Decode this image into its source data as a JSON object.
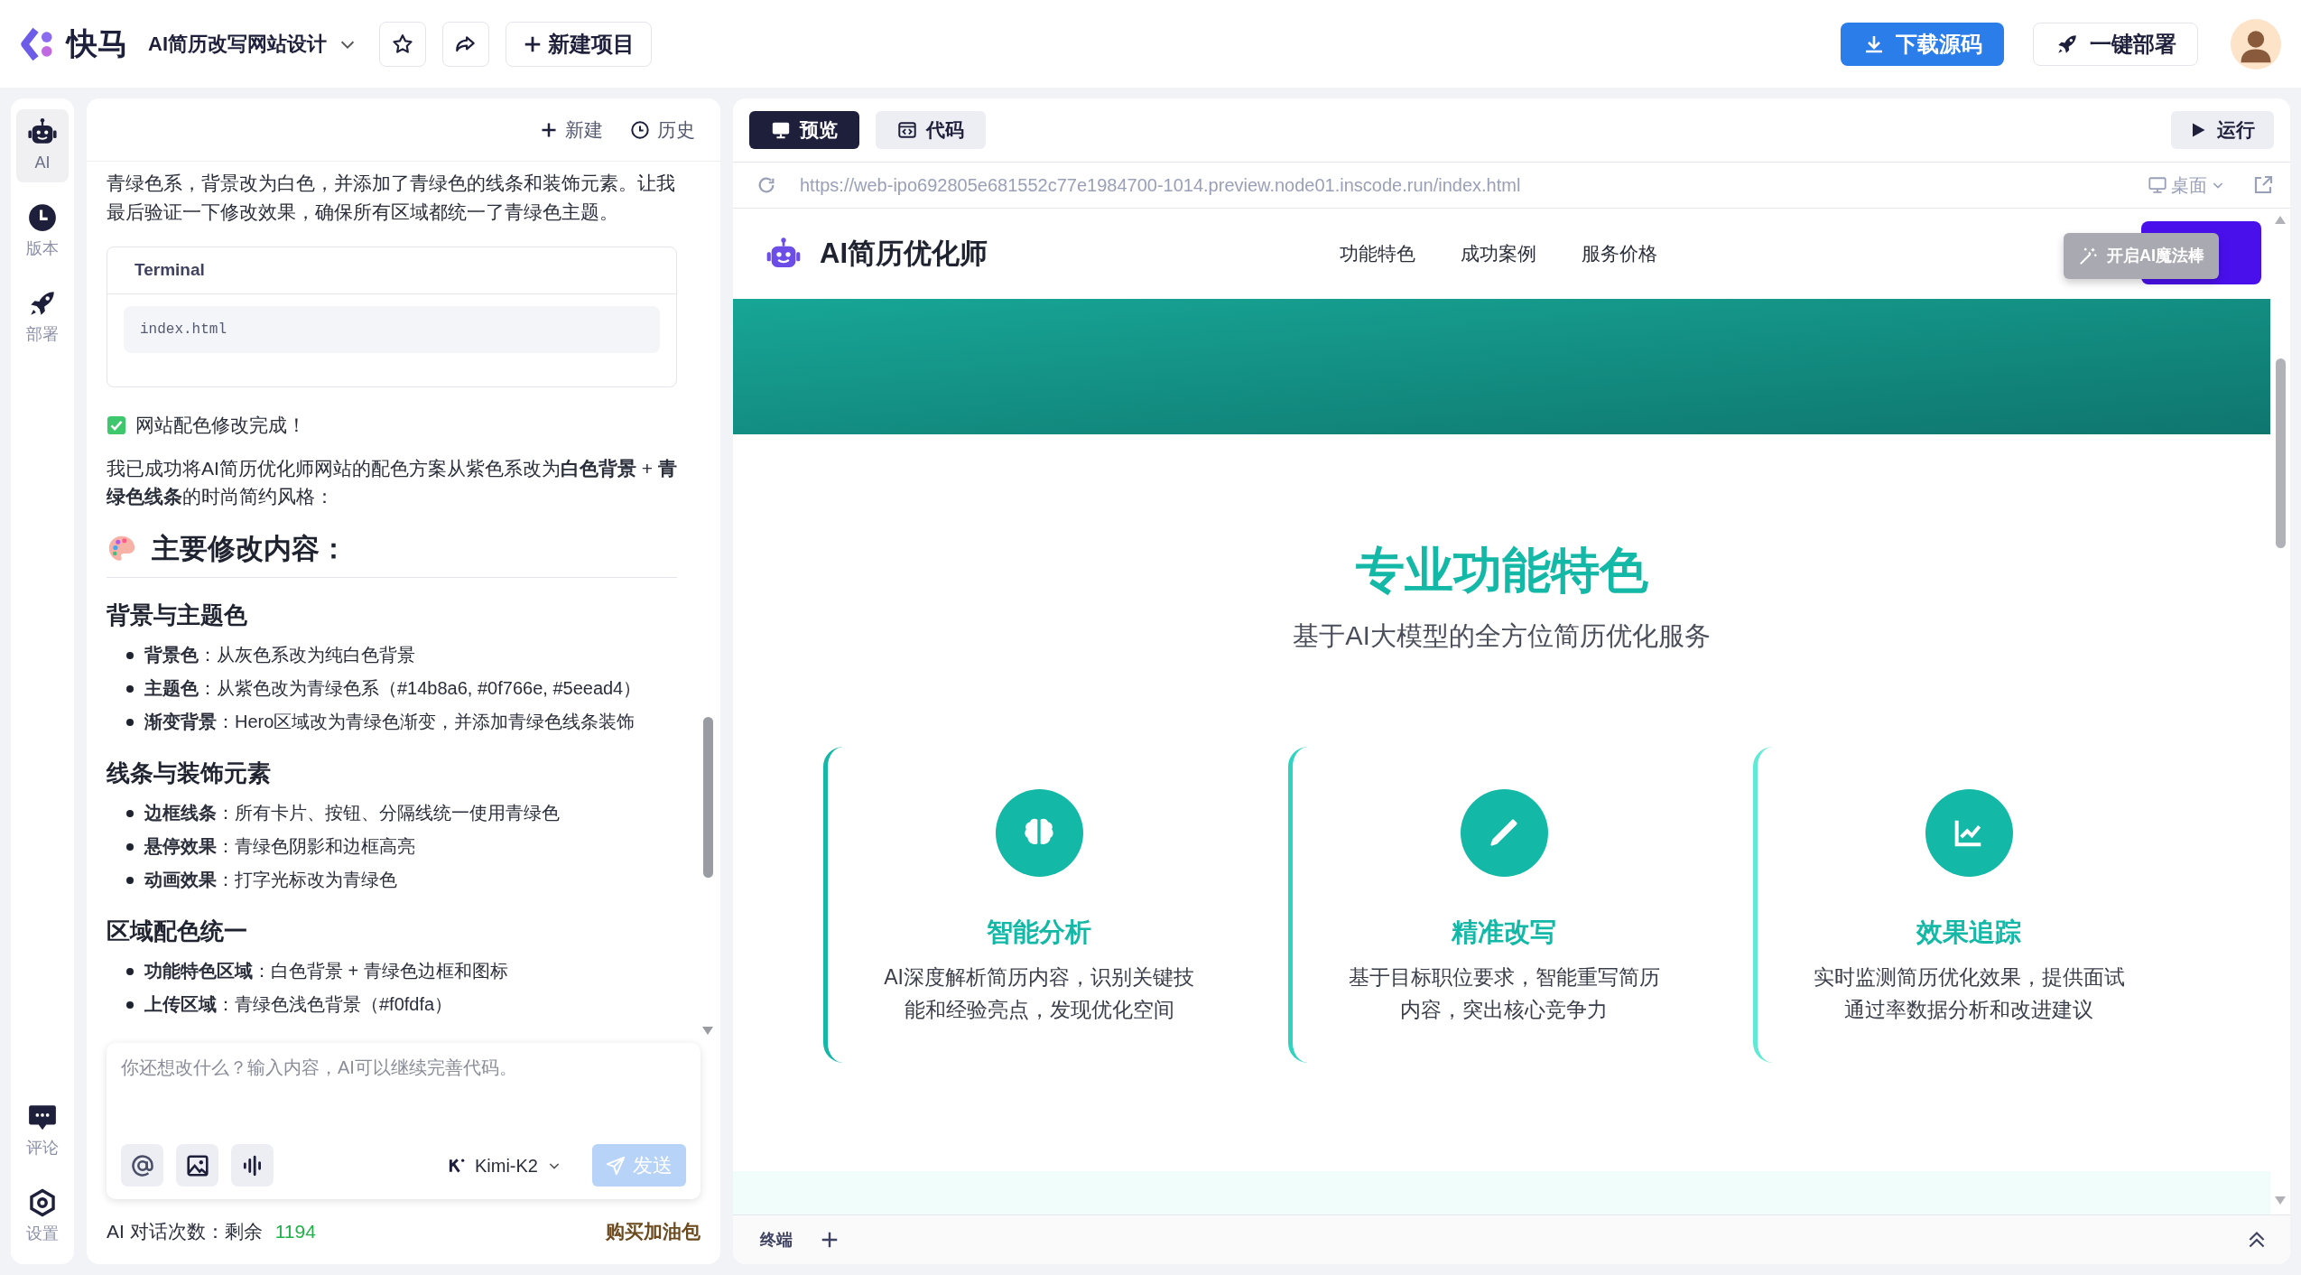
{
  "header": {
    "logo_text": "快马",
    "project_title": "AI简历改写网站设计",
    "new_project": "新建项目",
    "download": "下载源码",
    "deploy": "一键部署"
  },
  "rail": {
    "top": [
      {
        "label": "AI",
        "kind": "robot",
        "selected": true
      },
      {
        "label": "版本",
        "kind": "clock",
        "selected": false
      },
      {
        "label": "部署",
        "kind": "rocket",
        "selected": false
      }
    ],
    "bottom": [
      {
        "label": "评论",
        "kind": "chat",
        "selected": false
      },
      {
        "label": "设置",
        "kind": "settings",
        "selected": false
      }
    ]
  },
  "chat": {
    "actions": [
      {
        "label": "新建",
        "kind": "plus"
      },
      {
        "label": "历史",
        "kind": "history"
      }
    ],
    "intro": "青绿色系，背景改为白色，并添加了青绿色的线条和装饰元素。让我最后验证一下修改效果，确保所有区域都统一了青绿色主题。",
    "terminal": {
      "title": "Terminal",
      "file": "index.html"
    },
    "done": "网站配色修改完成！",
    "summary": "我已成功将AI简历优化师网站的配色方案从紫色系改为**白色背景** + **青绿色线条**的时尚简约风格：",
    "heading": "主要修改内容：",
    "sections": [
      {
        "title": "背景与主题色",
        "items": [
          "**背景色**：从灰色系改为纯白色背景",
          "**主题色**：从紫色改为青绿色系（#14b8a6, #0f766e, #5eead4）",
          "**渐变背景**：Hero区域改为青绿色渐变，并添加青绿色线条装饰"
        ]
      },
      {
        "title": "线条与装饰元素",
        "items": [
          "**边框线条**：所有卡片、按钮、分隔线统一使用青绿色",
          "**悬停效果**：青绿色阴影和边框高亮",
          "**动画效果**：打字光标改为青绿色"
        ]
      },
      {
        "title": "区域配色统一",
        "items": [
          "**功能特色区域**：白色背景 + 青绿色边框和图标",
          "**上传区域**：青绿色浅色背景（#f0fdfa）"
        ]
      }
    ],
    "input": {
      "placeholder": "你还想改什么？输入内容，AI可以继续完善代码。",
      "model": "Kimi-K2",
      "send": "发送",
      "send_disabled": true
    },
    "usage_label": "AI 对话次数：剩余",
    "usage_count": "1194",
    "buy": "购买加油包"
  },
  "preview": {
    "tabs": [
      {
        "label": "预览",
        "kind": "monitor",
        "selected": true
      },
      {
        "label": "代码",
        "kind": "code",
        "selected": false
      }
    ],
    "run": "运行",
    "url": "https://web-ipo692805e681552c77e1984700-1014.preview.node01.inscode.run/index.html",
    "device": "桌面",
    "site": {
      "brand": "AI简历优化师",
      "nav": [
        "功能特色",
        "成功案例",
        "服务价格"
      ],
      "tooltip": "开启AI魔法棒",
      "title": "专业功能特色",
      "subtitle": "基于AI大模型的全方位简历优化服务",
      "features": [
        {
          "kind": "brain",
          "title": "智能分析",
          "text": "AI深度解析简历内容，识别关键技能和经验亮点，发现优化空间"
        },
        {
          "kind": "pen",
          "title": "精准改写",
          "text": "基于目标职位要求，智能重写简历内容，突出核心竞争力"
        },
        {
          "kind": "chart",
          "title": "效果追踪",
          "text": "实时监测简历优化效果，提供面试通过率数据分析和改进建议"
        }
      ]
    },
    "terminal_tab": "终端"
  }
}
